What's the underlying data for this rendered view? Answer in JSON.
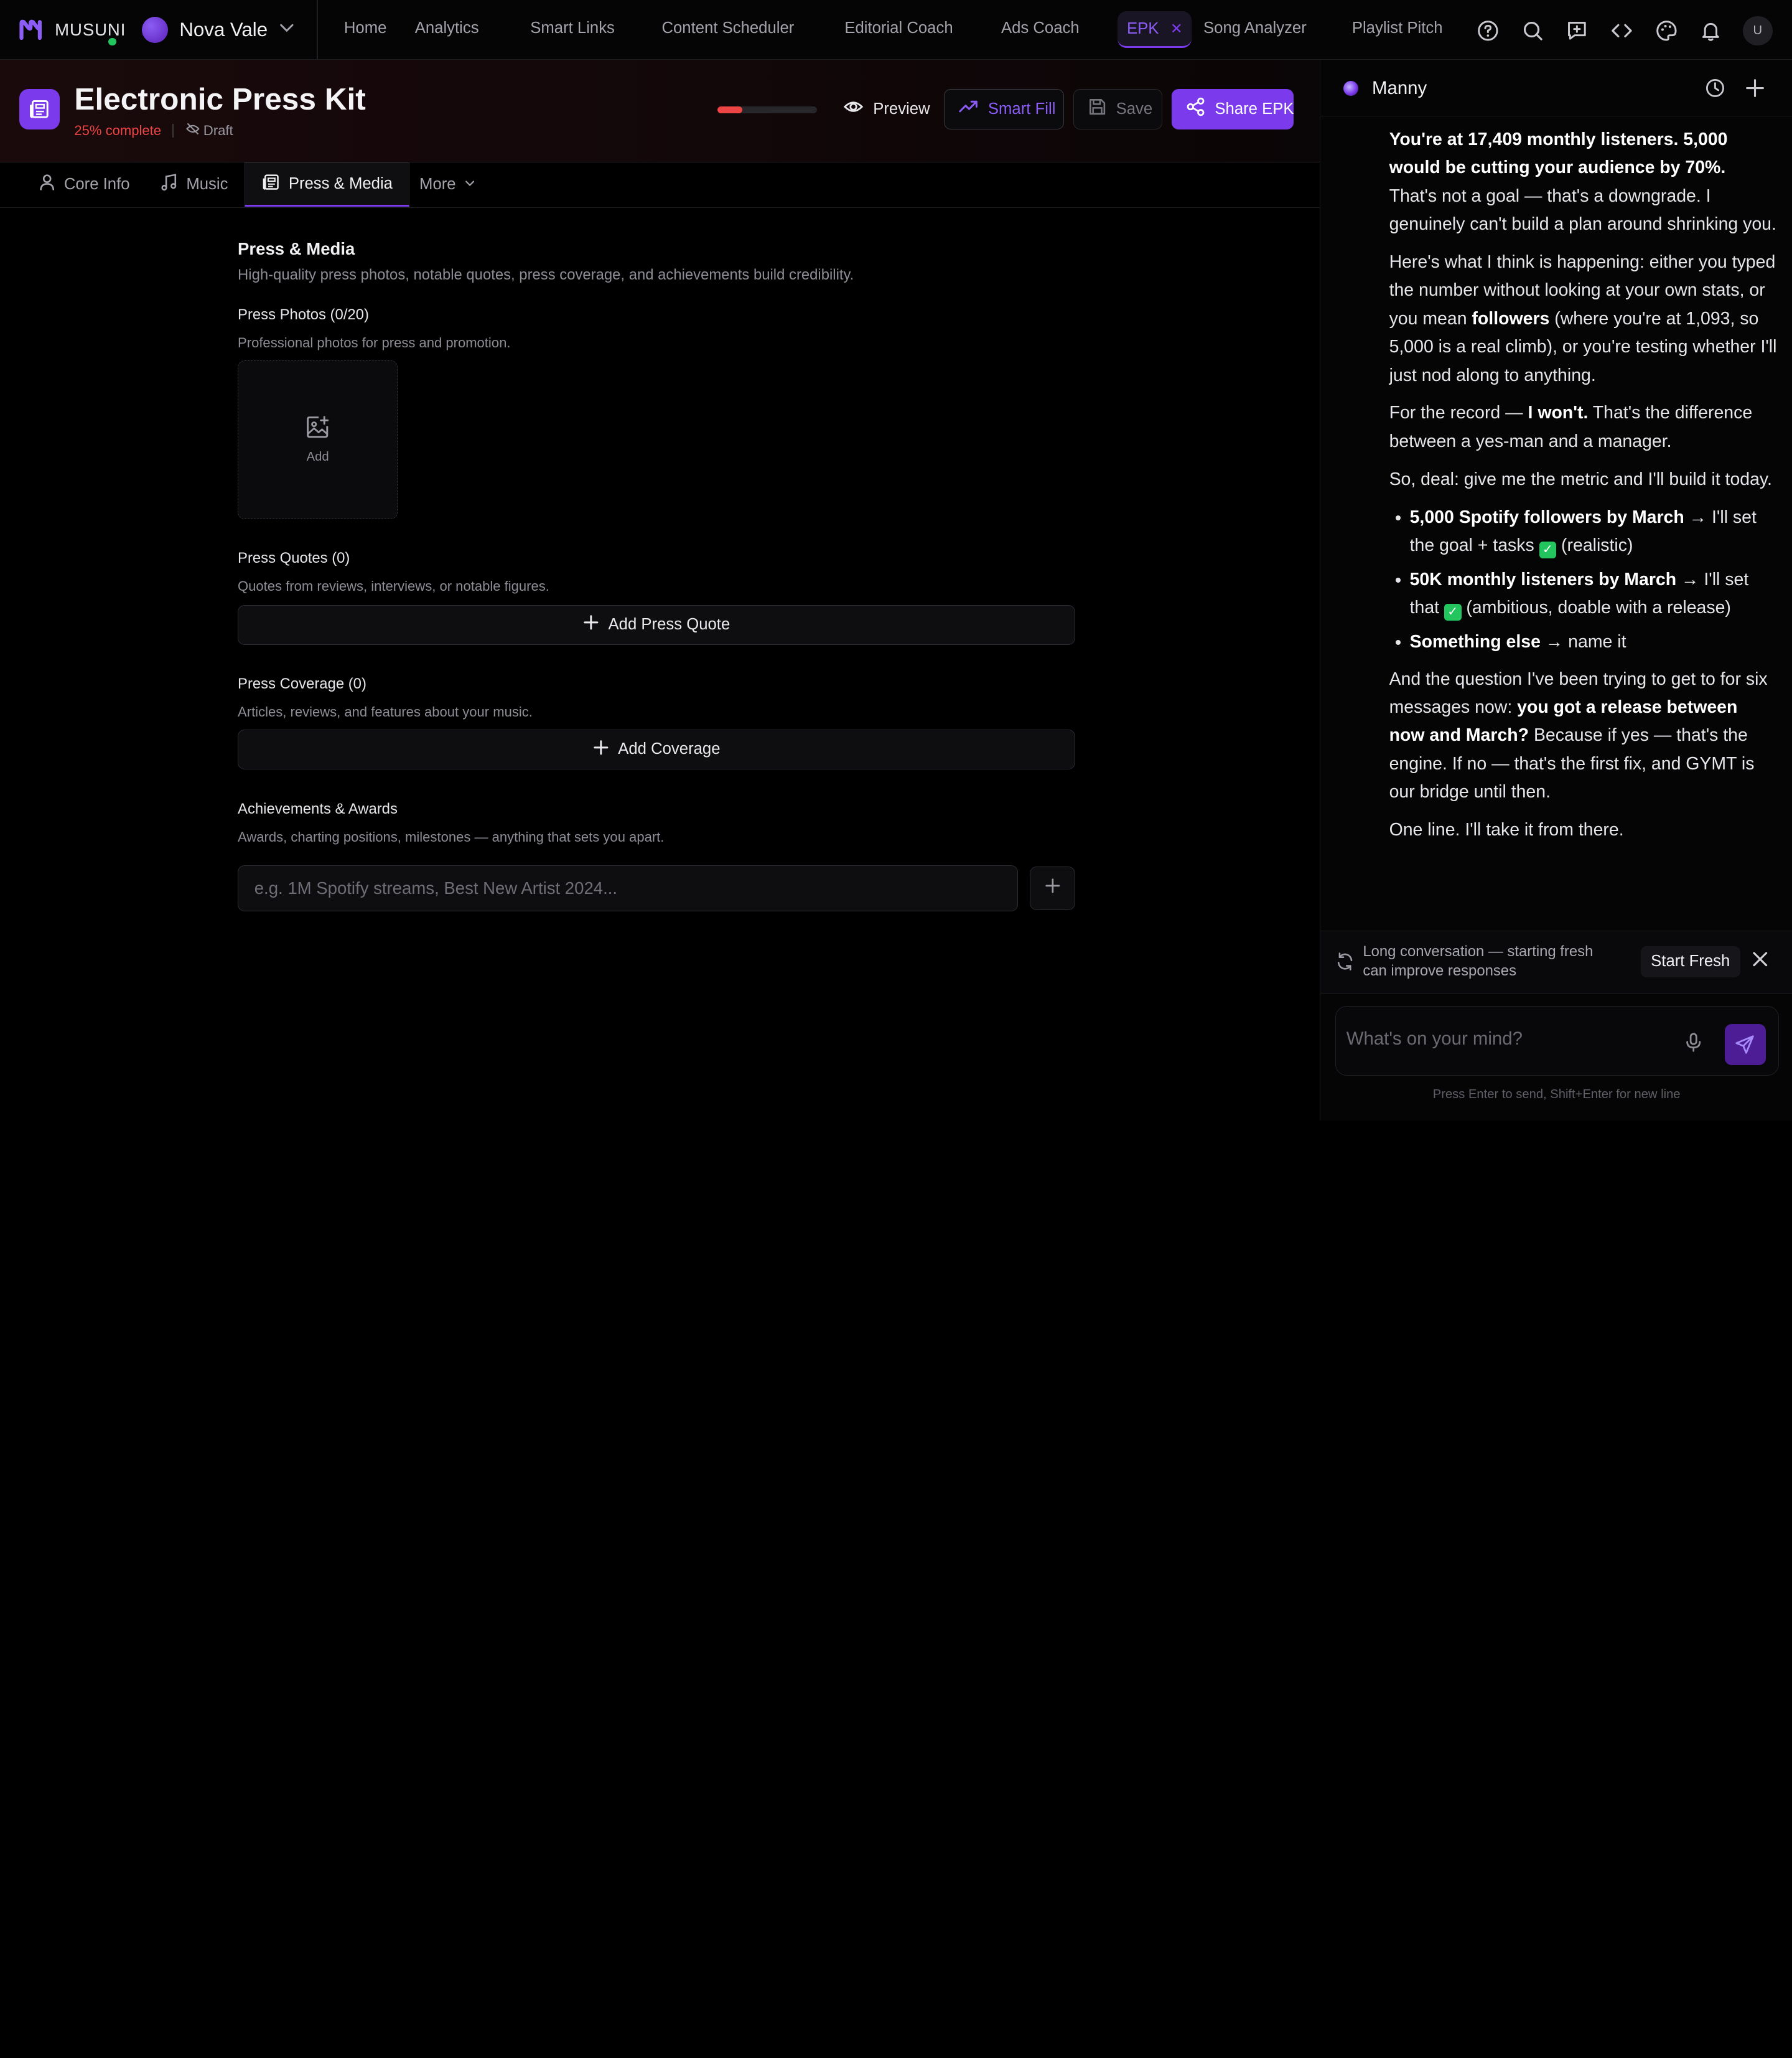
{
  "app": {
    "brand": "MUSUNI",
    "artist": "Nova Vale"
  },
  "nav": {
    "links": [
      "Home",
      "Analytics",
      "Smart Links",
      "Content Scheduler",
      "Editorial Coach",
      "Ads Coach",
      "EPK",
      "Song Analyzer",
      "Playlist Pitch"
    ],
    "active": "EPK",
    "user_initial": "U",
    "icons": [
      "help-icon",
      "search-icon",
      "feedback-icon",
      "code-icon",
      "palette-icon",
      "bell-icon"
    ]
  },
  "header": {
    "title": "Electronic Press Kit",
    "completion": "25% complete",
    "completion_value": 0.25,
    "status": "Draft",
    "preview_label": "Preview",
    "smart_fill_label": "Smart Fill",
    "save_label": "Save",
    "share_label": "Share EPK"
  },
  "tabs": [
    "Core Info",
    "Music",
    "Press & Media",
    "More"
  ],
  "section": {
    "title": "Press & Media",
    "description": "High-quality press photos, notable quotes, press coverage, and achievements build credibility.",
    "photos": {
      "label": "Press Photos (0/20)",
      "description": "Professional photos for press and promotion.",
      "add_label": "Add"
    },
    "quotes": {
      "label": "Press Quotes (0)",
      "description": "Quotes from reviews, interviews, or notable figures.",
      "button": "Add Press Quote"
    },
    "coverage": {
      "label": "Press Coverage (0)",
      "description": "Articles, reviews, and features about your music.",
      "button": "Add Coverage"
    },
    "achievements": {
      "label": "Achievements & Awards",
      "description": "Awards, charting positions, milestones — anything that sets you apart.",
      "placeholder": "e.g. 1M Spotify streams, Best New Artist 2024..."
    }
  },
  "chat": {
    "assistant_name": "Manny",
    "messages": {
      "p1_bold": "You're at 17,409 monthly listeners. 5,000 would be cutting your audience by 70%.",
      "p1_rest": " That's not a goal — that's a downgrade. I genuinely can't build a plan around shrinking you.",
      "p2_a": "Here's what I think is happening: either you typed the number without looking at your own stats, or you mean ",
      "p2_bold": "followers",
      "p2_b": " (where you're at 1,093, so 5,000 is a real climb), or you're testing whether I'll just nod along to anything.",
      "p3_a": "For the record — ",
      "p3_bold": "I won't.",
      "p3_b": " That's the difference between a yes-man and a manager.",
      "p4": "So, deal: give me the metric and I'll build it today.",
      "bullets": [
        {
          "bold": "5,000 Spotify followers by March",
          "a": " → I'll set the goal + tasks ",
          "b": " (realistic)"
        },
        {
          "bold": "50K monthly listeners by March",
          "a": " → I'll set that ",
          "b": " (ambitious, doable with a release)"
        },
        {
          "bold": "Something else",
          "a": " → name it",
          "b": ""
        }
      ],
      "p5_a": "And the question I've been trying to get to for six messages now: ",
      "p5_bold": "you got a release between now and March?",
      "p5_b": " Because if yes — that's the engine. If no — that's the first fix, and GYMT is our bridge until then.",
      "p6": "One line. I'll take it from there."
    },
    "notice": "Long conversation — starting fresh can improve responses",
    "fresh_label": "Start Fresh",
    "input_placeholder": "What's on your mind?",
    "hint": "Press Enter to send, Shift+Enter for new line"
  },
  "colors": {
    "accent": "#7c3aed",
    "danger": "#ef4444",
    "success": "#22c55e",
    "background": "#000000"
  }
}
